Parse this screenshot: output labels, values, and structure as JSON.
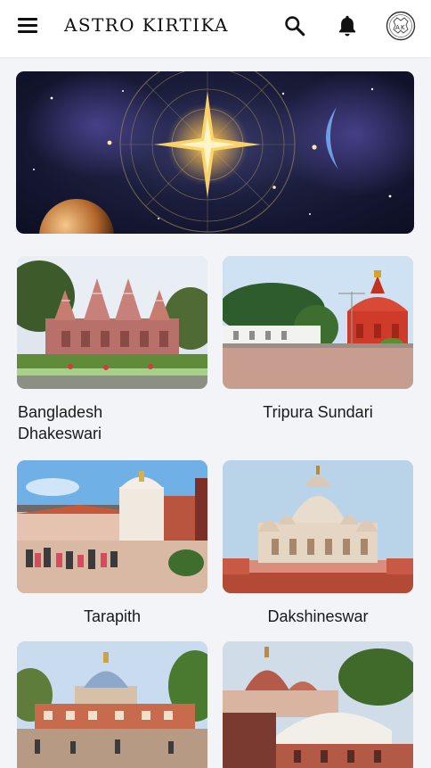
{
  "header": {
    "brand": "ASTRO KIRTIKA",
    "icons": [
      "menu-icon",
      "search-icon",
      "bell-icon",
      "avatar-icon"
    ]
  },
  "banner": {
    "description_icon": "zodiac-banner"
  },
  "temples": [
    {
      "name": "Bangladesh Dhakeswari"
    },
    {
      "name": "Tripura Sundari"
    },
    {
      "name": "Tarapith"
    },
    {
      "name": "Dakshineswar"
    },
    {
      "name": ""
    },
    {
      "name": ""
    }
  ],
  "colors": {
    "header_bg": "#ffffff",
    "page_bg": "#f3f4f8",
    "text": "#1a1a1a"
  }
}
